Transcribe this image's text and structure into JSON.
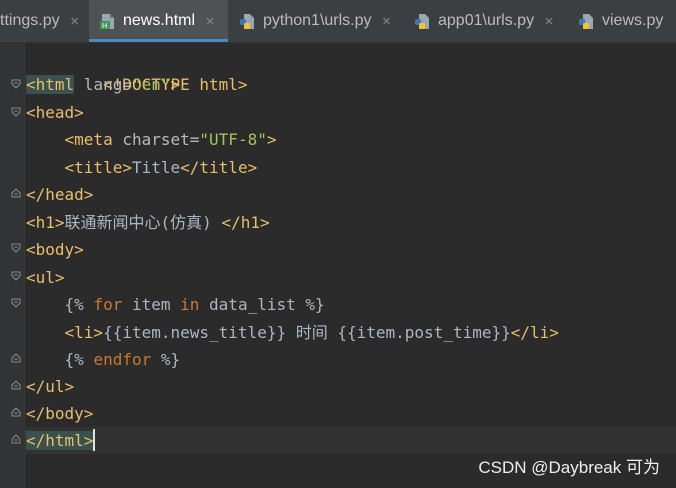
{
  "tabs": [
    {
      "label": "ttings.py",
      "icon": "python-file-icon",
      "active": false
    },
    {
      "label": "news.html",
      "icon": "html-file-icon",
      "active": true
    },
    {
      "label": "python1\\urls.py",
      "icon": "python-file-icon",
      "active": false
    },
    {
      "label": "app01\\urls.py",
      "icon": "python-file-icon",
      "active": false
    },
    {
      "label": "views.py",
      "icon": "python-file-icon",
      "active": false
    }
  ],
  "close_glyph": "×",
  "editor": {
    "lines": {
      "l1": {
        "doctype": "<!DOCTYPE html>"
      },
      "l2": {
        "open": "<html",
        "attr": " lang=",
        "val": "\"en\"",
        "close": ">"
      },
      "l3": {
        "tag": "<head>"
      },
      "l4": {
        "indent": "    ",
        "open": "<meta",
        "attr": " charset=",
        "val": "\"UTF-8\"",
        "close": ">"
      },
      "l5": {
        "indent": "    ",
        "open": "<title>",
        "text": "Title",
        "close": "</title>"
      },
      "l6": {
        "tag": "</head>"
      },
      "l7": {
        "open": "<h1>",
        "text": "联通新闻中心(仿真) ",
        "close": "</h1>"
      },
      "l8": {
        "tag": "<body>"
      },
      "l9": {
        "tag": "<ul>"
      },
      "l10": {
        "indent": "    ",
        "p1": "{% ",
        "k1": "for",
        "p2": " item ",
        "k2": "in",
        "p3": " data_list %}"
      },
      "l11": {
        "indent": "    ",
        "open": "<li>",
        "text": "{{item.news_title}} 时间 {{item.post_time}}",
        "close": "</li>"
      },
      "l12": {
        "indent": "    ",
        "p1": "{% ",
        "k1": "endfor",
        "p2": " %}"
      },
      "l13": {
        "tag": "</ul>"
      },
      "l14": {
        "tag": "</body>"
      },
      "l15": {
        "tag": "</html>"
      }
    }
  },
  "watermark": "CSDN @Daybreak 可为",
  "colors": {
    "background": "#2b2b2b",
    "tabbar": "#3c3f41",
    "active_tab": "#4e5254",
    "tab_accent": "#4a88c7",
    "tag": "#e8bf6a",
    "attr_value": "#a5c25c",
    "keyword": "#cc7832",
    "plain": "#a9b7c6"
  }
}
